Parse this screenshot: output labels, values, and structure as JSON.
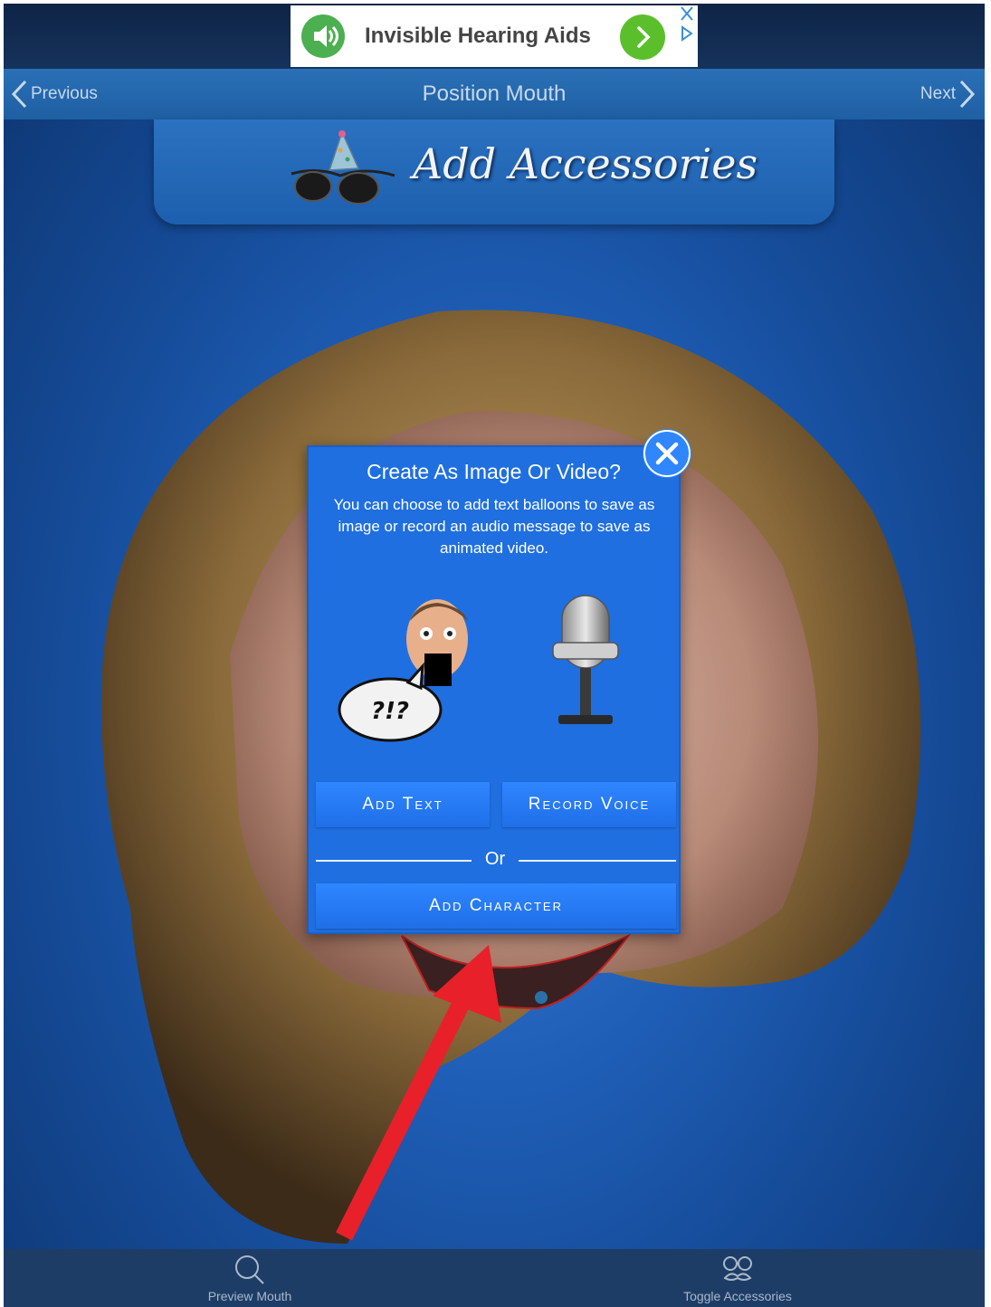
{
  "ad": {
    "title": "Invisible Hearing Aids",
    "speaker_icon": "speaker-icon",
    "arrow_icon": "chevron-right-icon",
    "close_icon": "close-icon",
    "adchoices_icon": "play-icon"
  },
  "nav": {
    "previous_label": "Previous",
    "title": "Position Mouth",
    "next_label": "Next"
  },
  "banner": {
    "title": "Add Accessories",
    "icon": "accessories-icon"
  },
  "modal": {
    "title": "Create As Image Or Video?",
    "description": "You can choose to add text balloons to save as image or record an audio message to save as animated video.",
    "speech_bubble_text": "?!?",
    "add_text_label": "Add Text",
    "record_voice_label": "Record Voice",
    "or_label": "Or",
    "add_character_label": "Add Character"
  },
  "toolbar": {
    "preview_label": "Preview Mouth",
    "toggle_label": "Toggle Accessories"
  },
  "colors": {
    "modal_bg": "#1f6fe0",
    "button": "#2f86ff",
    "annotation_arrow": "#e8202a",
    "nav_bg": "#2a70b6"
  }
}
